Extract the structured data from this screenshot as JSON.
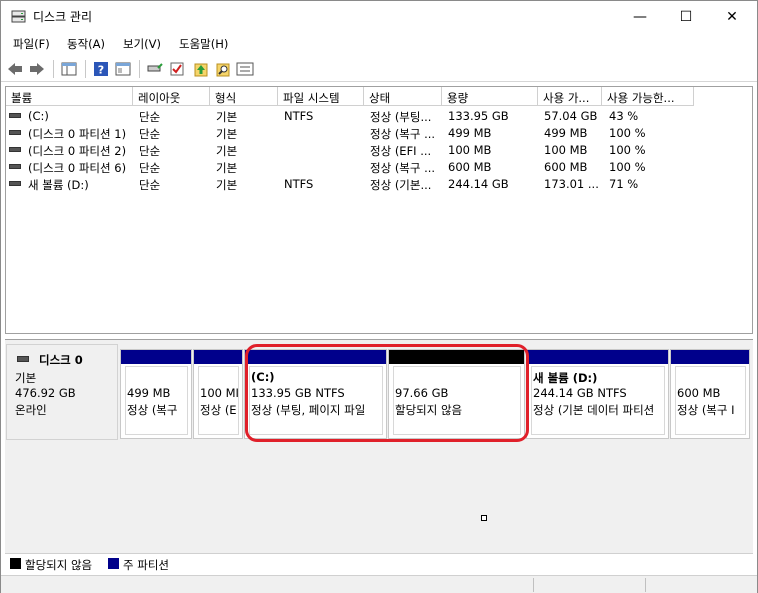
{
  "window": {
    "title": "디스크 관리",
    "minimize_glyph": "—",
    "maximize_glyph": "☐",
    "close_glyph": "✕"
  },
  "menu": [
    {
      "label": "파일(F)"
    },
    {
      "label": "동작(A)"
    },
    {
      "label": "보기(V)"
    },
    {
      "label": "도움말(H)"
    }
  ],
  "toolbar": {
    "icons": [
      "back-icon",
      "forward-icon",
      "console-tree-icon",
      "help-icon",
      "view-icon",
      "connect-disk-icon",
      "check-icon",
      "up-arrow-icon",
      "search-icon",
      "properties-icon"
    ]
  },
  "volume_list": {
    "columns": [
      "볼륨",
      "레이아웃",
      "형식",
      "파일 시스템",
      "상태",
      "용량",
      "사용 가...",
      "사용 가능한..."
    ],
    "rows": [
      [
        "(C:)",
        "단순",
        "기본",
        "NTFS",
        "정상 (부팅...",
        "133.95 GB",
        "57.04 GB",
        "43 %"
      ],
      [
        "(디스크 0 파티션 1)",
        "단순",
        "기본",
        "",
        "정상 (복구 ...",
        "499 MB",
        "499 MB",
        "100 %"
      ],
      [
        "(디스크 0 파티션 2)",
        "단순",
        "기본",
        "",
        "정상 (EFI ...",
        "100 MB",
        "100 MB",
        "100 %"
      ],
      [
        "(디스크 0 파티션 6)",
        "단순",
        "기본",
        "",
        "정상 (복구 ...",
        "600 MB",
        "600 MB",
        "100 %"
      ],
      [
        "새 볼륨 (D:)",
        "단순",
        "기본",
        "NTFS",
        "정상 (기본...",
        "244.14 GB",
        "173.01 ...",
        "71 %"
      ]
    ]
  },
  "disk": {
    "name": "디스크 0",
    "type": "기본",
    "size": "476.92 GB",
    "status": "온라인",
    "partitions": [
      {
        "title": "",
        "size": "499 MB",
        "status": "정상 (복구",
        "unallocated": false
      },
      {
        "title": "",
        "size": "100 MI",
        "status": "정상 (E",
        "unallocated": false
      },
      {
        "title": "(C:)",
        "size": "133.95 GB NTFS",
        "status": "정상 (부팅, 페이지 파일",
        "unallocated": false
      },
      {
        "title": "",
        "size": "97.66 GB",
        "status": "할당되지 않음",
        "unallocated": true
      },
      {
        "title": "새 볼륨  (D:)",
        "size": "244.14 GB NTFS",
        "status": "정상 (기본 데이터 파티션",
        "unallocated": false
      },
      {
        "title": "",
        "size": "600 MB",
        "status": "정상 (복구 I",
        "unallocated": false
      }
    ]
  },
  "legend": [
    {
      "label": "할당되지 않음",
      "color": "#000000"
    },
    {
      "label": "주 파티션",
      "color": "#00008b"
    }
  ]
}
